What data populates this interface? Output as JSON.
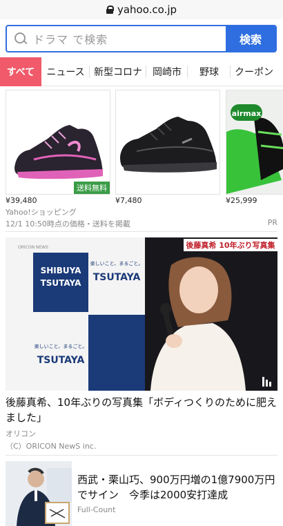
{
  "browser": {
    "url": "yahoo.co.jp"
  },
  "search": {
    "placeholder": "ドラマ で検索",
    "button_label": "検索"
  },
  "tabs": [
    {
      "label": "すべて",
      "active": true
    },
    {
      "label": "ニュース"
    },
    {
      "label": "新型コロナ"
    },
    {
      "label": "岡崎市"
    },
    {
      "label": "野球"
    },
    {
      "label": "クーポン"
    }
  ],
  "products": [
    {
      "price": "¥39,480",
      "badge": "送料無料"
    },
    {
      "price": "¥7,480"
    },
    {
      "price": "¥25,999",
      "brand_logo": "airmax"
    }
  ],
  "shopping": {
    "source": "Yahoo!ショッピング",
    "note": "12/1 10:50時点の価格・送料を掲載",
    "pr": "PR"
  },
  "news": [
    {
      "headline": "後藤真希、10年ぶりの写真集「ボディつくりのために肥えました」",
      "source": "オリコン",
      "copyright": "（C）ORICON NewS inc.",
      "image": {
        "ticker": "後藤真希 10年ぶり写真集",
        "logo": "ORICON NEWS",
        "panel_a": [
          "SHIBUYA",
          "TSUTAYA"
        ],
        "panel_b_small": "楽しいこと、まるごと。",
        "panel_b_big": "TSUTAYA"
      }
    },
    {
      "headline": "西武・栗山巧、900万円増の1億7900万円でサイン　今季は2000安打達成",
      "source": "Full-Count"
    }
  ]
}
